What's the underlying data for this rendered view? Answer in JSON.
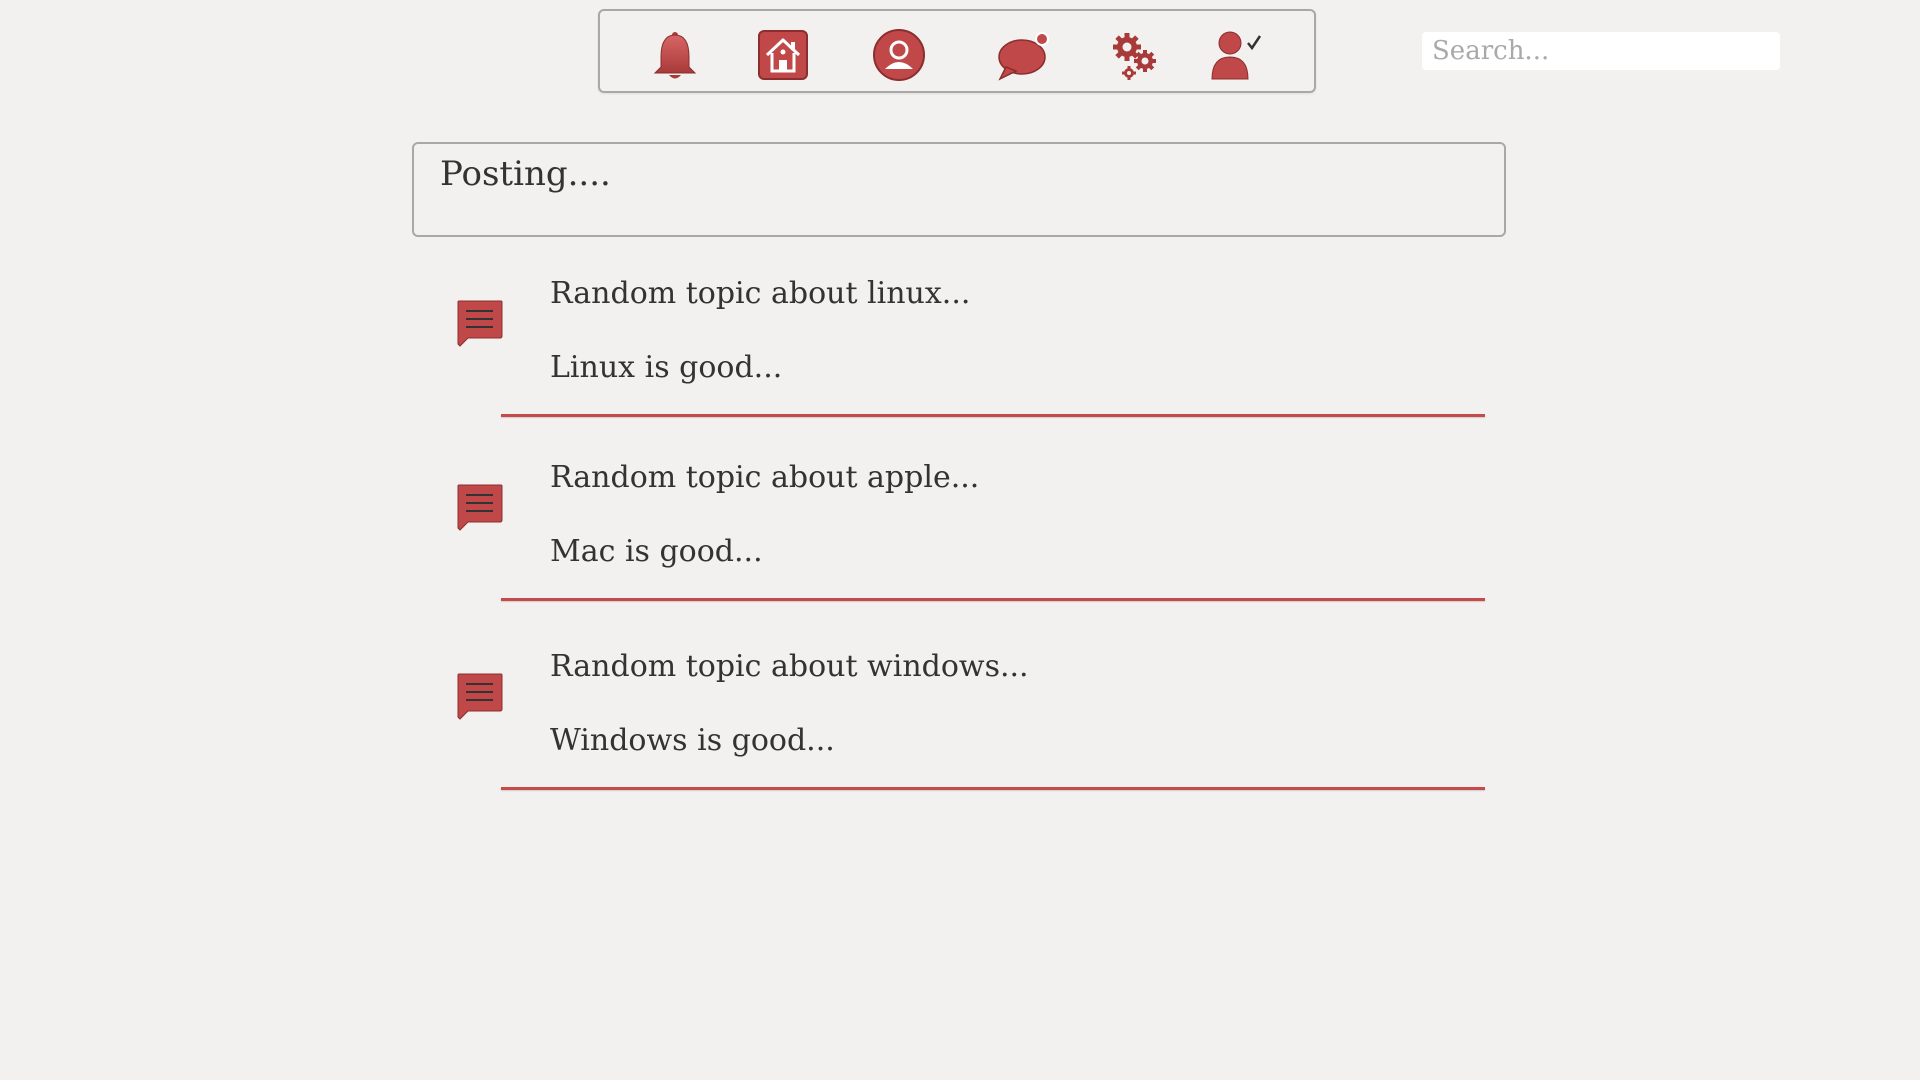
{
  "nav": {
    "icons": [
      {
        "name": "notifications",
        "icon": "bell-icon"
      },
      {
        "name": "home",
        "icon": "home-icon"
      },
      {
        "name": "profile",
        "icon": "user-circle-icon"
      },
      {
        "name": "messages",
        "icon": "chat-bubble-icon"
      },
      {
        "name": "settings",
        "icon": "gears-icon"
      },
      {
        "name": "account-verified",
        "icon": "user-check-icon"
      }
    ]
  },
  "search": {
    "placeholder": "Search...",
    "value": ""
  },
  "posting": {
    "placeholder": "Posting...."
  },
  "posts": [
    {
      "title": "Random topic about linux...",
      "body": "Linux is good...",
      "icon": "message-icon"
    },
    {
      "title": "Random topic about apple...",
      "body": "Mac is good...",
      "icon": "message-icon"
    },
    {
      "title": "Random topic about windows...",
      "body": "Windows is good...",
      "icon": "message-icon"
    }
  ],
  "colors": {
    "accent": "#c54a4a",
    "background": "#f3f1ef",
    "border": "#a8a8a8",
    "text": "#333333"
  }
}
